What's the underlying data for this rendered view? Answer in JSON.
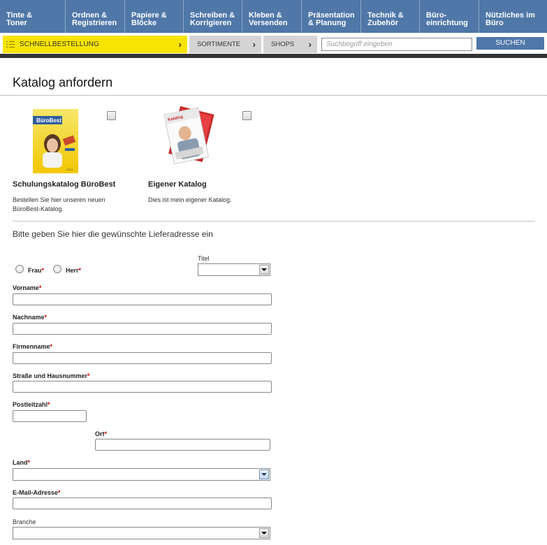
{
  "topnav": [
    {
      "line1": "Tinte &",
      "line2": "Toner"
    },
    {
      "line1": "Ordnen &",
      "line2": "Registrieren"
    },
    {
      "line1": "Papiere &",
      "line2": "Blöcke"
    },
    {
      "line1": "Schreiben &",
      "line2": "Korrigieren"
    },
    {
      "line1": "Kleben &",
      "line2": "Versenden"
    },
    {
      "line1": "Präsentation",
      "line2": "& Planung"
    },
    {
      "line1": "Technik &",
      "line2": "Zubehör"
    },
    {
      "line1": "Büro-",
      "line2": "einrichtung"
    },
    {
      "line1": "Nützliches im",
      "line2": "Büro"
    }
  ],
  "subbar": {
    "quick_label": "SCHNELLBESTELLUNG",
    "sortimente_label": "SORTIMENTE",
    "shops_label": "SHOPS",
    "chevron": "›",
    "search_placeholder": "Suchbegriff eingeben",
    "search_button": "SUCHEN"
  },
  "page": {
    "title": "Katalog anfordern",
    "catalogs": [
      {
        "cover_label": "BüroBest",
        "cover_year": "2013",
        "title": "Schulungskatalog BüroBest",
        "desc_line1": "Bestellen Sie hier unseren neuen",
        "desc_line2": "BüroBest-Katalog."
      },
      {
        "cover_label": "Katalog",
        "title": "Eigener Katalog",
        "desc_line1": "Dies ist mein eigener Katalog.",
        "desc_line2": ""
      }
    ],
    "address_heading": "Bitte geben Sie hier die gewünschte Lieferadresse ein"
  },
  "form": {
    "salutation_frau": "Frau",
    "salutation_herr": "Herr",
    "required_mark": "*",
    "titel_label": "Titel",
    "vorname_label": "Vorname",
    "nachname_label": "Nachname",
    "firmenname_label": "Firmenname",
    "strasse_label": "Straße und Hausnummer",
    "plz_label": "Postleitzahl",
    "ort_label": "Ort",
    "land_label": "Land",
    "email_label": "E-Mail-Adresse",
    "branche_label": "Branche"
  },
  "colors": {
    "nav_blue": "#4f77a8",
    "quick_yellow": "#f7e400",
    "required_red": "#c00000"
  }
}
